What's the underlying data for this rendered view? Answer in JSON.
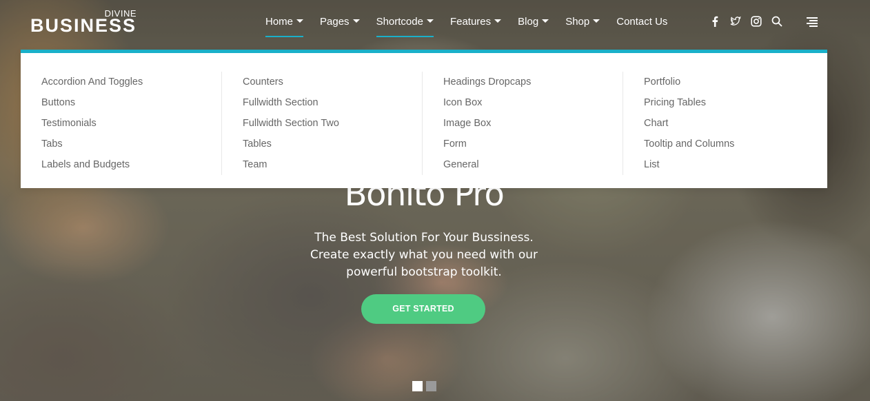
{
  "logo": {
    "top": "DIVINE",
    "main": "BUSINESS"
  },
  "nav": [
    {
      "label": "Home",
      "dropdown": true,
      "active": true
    },
    {
      "label": "Pages",
      "dropdown": true,
      "active": false
    },
    {
      "label": "Shortcode",
      "dropdown": true,
      "active": true
    },
    {
      "label": "Features",
      "dropdown": true,
      "active": false
    },
    {
      "label": "Blog",
      "dropdown": true,
      "active": false
    },
    {
      "label": "Shop",
      "dropdown": true,
      "active": false
    },
    {
      "label": "Contact Us",
      "dropdown": false,
      "active": false
    }
  ],
  "social_icons": [
    "facebook-icon",
    "twitter-icon",
    "instagram-icon",
    "search-icon"
  ],
  "menu_icon": "hamburger-menu-icon",
  "mega_menu": {
    "columns": [
      [
        "Accordion And Toggles",
        "Buttons",
        "Testimonials",
        "Tabs",
        "Labels and Budgets"
      ],
      [
        "Counters",
        "Fullwidth Section",
        "Fullwidth Section Two",
        "Tables",
        "Team"
      ],
      [
        "Headings Dropcaps",
        "Icon Box",
        "Image Box",
        "Form",
        "General"
      ],
      [
        "Portfolio",
        "Pricing Tables",
        "Chart",
        "Tooltip and Columns",
        "List"
      ]
    ]
  },
  "hero": {
    "title": "Bonito Pro",
    "subtitle_lines": [
      "The Best Solution For Your Bussiness.",
      "Create exactly what you need with our",
      "powerful bootstrap toolkit."
    ],
    "cta_label": "GET STARTED"
  },
  "slider": {
    "total": 2,
    "active_index": 0
  },
  "colors": {
    "accent": "#1ab0c9",
    "cta": "#4fcb82",
    "menu_text": "#666666",
    "dot_active": "#ffffff",
    "dot_inactive": "#9a9a9a"
  }
}
